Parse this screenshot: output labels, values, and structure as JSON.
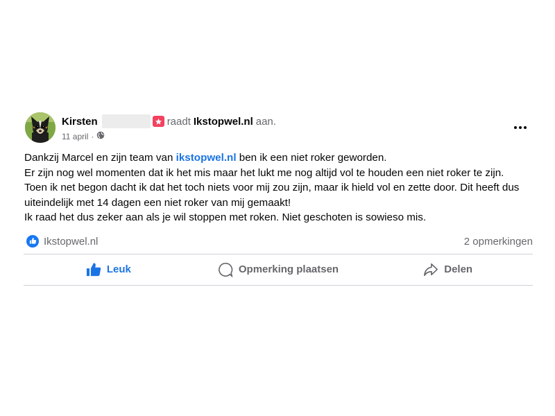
{
  "post": {
    "author": "Kirsten",
    "verb": "raadt",
    "page": "Ikstopwel.nl",
    "suffix": "aan.",
    "date": "11 april",
    "separator": "·",
    "privacy_icon": "globe-icon",
    "more_icon": "more-options-icon",
    "body": {
      "line1_before": "Dankzij Marcel en zijn team van ",
      "line1_link": "ikstopwel.nl",
      "line1_after": " ben ik een niet roker geworden.",
      "line2": "Er zijn nog wel momenten dat ik het mis maar het lukt me nog altijd vol te houden een niet roker te zijn.",
      "line3": "Toen ik net begon dacht ik dat het toch niets voor mij zou zijn, maar ik hield vol en zette door. Dit heeft dus uiteindelijk met 14 dagen een niet roker van mij gemaakt!",
      "line4": "Ik raad het dus zeker aan als je wil stoppen met roken. Niet geschoten is sowieso mis."
    },
    "reactions": {
      "icon": "like-icon",
      "name": "Ikstopwel.nl",
      "comments": "2 opmerkingen"
    },
    "actions": {
      "like": "Leuk",
      "comment": "Opmerking plaatsen",
      "share": "Delen"
    }
  },
  "colors": {
    "accent": "#1b74e4",
    "secondary_text": "#65676b",
    "badge": "#f3425f",
    "divider": "#ced0d4"
  }
}
